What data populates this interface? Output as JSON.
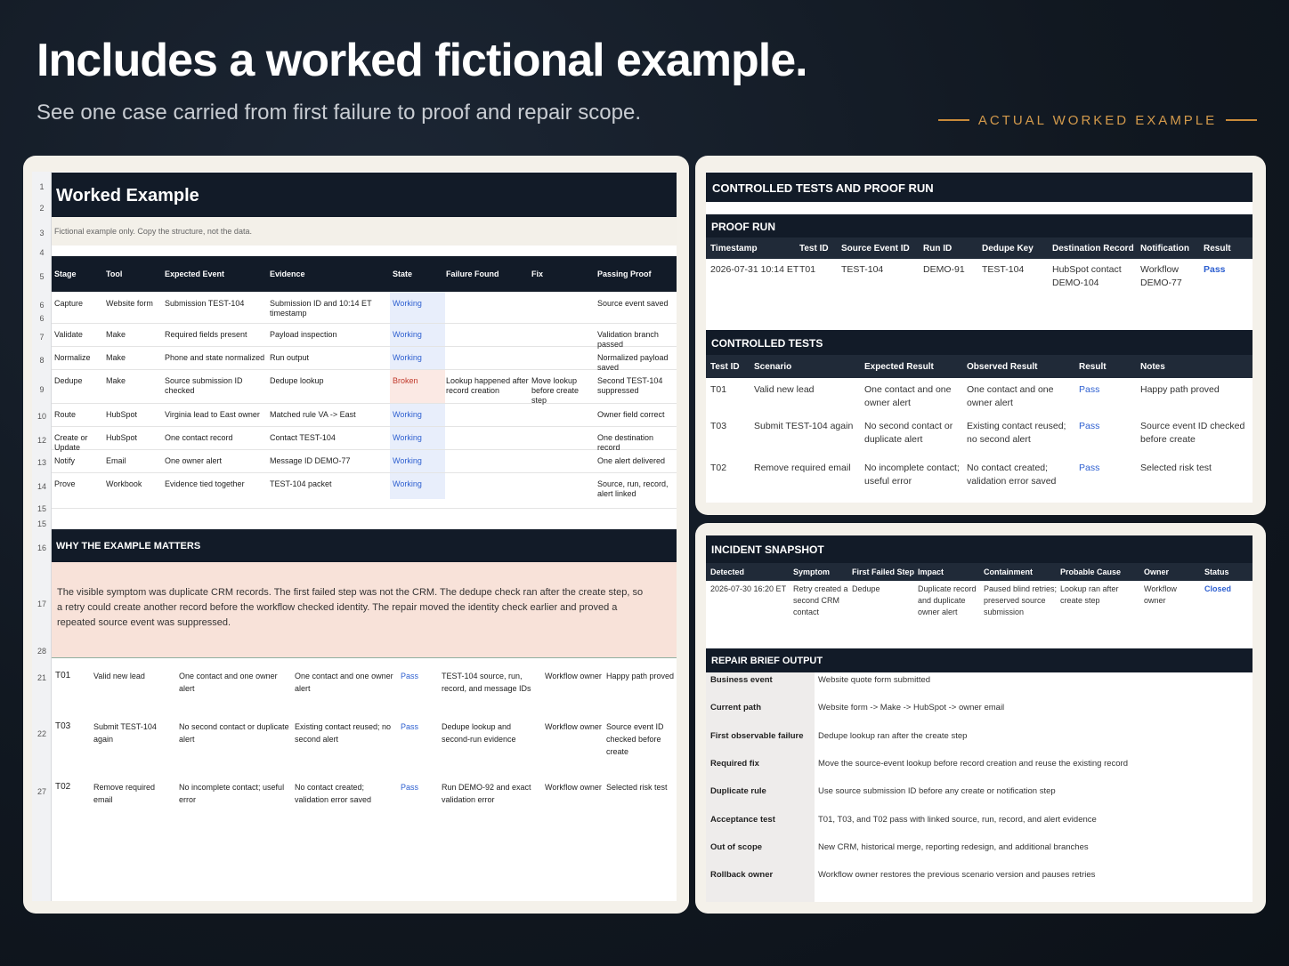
{
  "hero": {
    "title": "Includes a worked fictional example.",
    "subtitle": "See one case carried from first failure to proof and repair scope.",
    "tag": "ACTUAL WORKED EXAMPLE"
  },
  "colors": {
    "accent": "#d39a4c",
    "dark_header": "#121b28",
    "pass_blue": "#2d5fd0",
    "broken_red": "#c0392b"
  },
  "worksheet": {
    "row_numbers": [
      "1",
      "2",
      "3",
      "4",
      "5",
      "6",
      "6",
      "7",
      "8",
      "9",
      "10",
      "12",
      "13",
      "14",
      "15",
      "15",
      "16",
      "17",
      "28",
      "21",
      "22",
      "27"
    ],
    "title": "Worked Example",
    "note": "Fictional example only. Copy the structure, not the data.",
    "headers": [
      "Stage",
      "Tool",
      "Expected Event",
      "Evidence",
      "State",
      "Failure Found",
      "Fix",
      "Passing Proof"
    ],
    "rows": [
      [
        "Capture",
        "Website form",
        "Submission TEST-104",
        "Submission ID and 10:14 ET timestamp",
        "Working",
        "",
        "",
        "Source event saved"
      ],
      [
        "Validate",
        "Make",
        "Required fields present",
        "Payload inspection",
        "Working",
        "",
        "",
        "Validation branch passed"
      ],
      [
        "Normalize",
        "Make",
        "Phone and state normalized",
        "Run output",
        "Working",
        "",
        "",
        "Normalized payload saved"
      ],
      [
        "Dedupe",
        "Make",
        "Source submission ID checked",
        "Dedupe lookup",
        "Broken",
        "Lookup happened after record creation",
        "Move lookup before create step",
        "Second TEST-104 suppressed"
      ],
      [
        "Route",
        "HubSpot",
        "Virginia lead to East owner",
        "Matched rule VA -> East",
        "Working",
        "",
        "",
        "Owner field correct"
      ],
      [
        "Create or Update",
        "HubSpot",
        "One contact record",
        "Contact TEST-104",
        "Working",
        "",
        "",
        "One destination record"
      ],
      [
        "Notify",
        "Email",
        "One owner alert",
        "Message ID DEMO-77",
        "Working",
        "",
        "",
        "One alert delivered"
      ],
      [
        "Prove",
        "Workbook",
        "Evidence tied together",
        "TEST-104 packet",
        "Working",
        "",
        "",
        "Source, run, record, alert linked"
      ]
    ],
    "why_heading": "WHY THE EXAMPLE MATTERS",
    "why_text": "The visible symptom was duplicate CRM records. The first failed step was not the CRM. The dedupe check ran after the create step, so a retry could create another record before the workflow checked identity. The repair moved the identity check earlier and proved a repeated source event was suppressed.",
    "test_rows": [
      [
        "T01",
        "Valid new lead",
        "One contact and one owner alert",
        "One contact and one owner alert",
        "Pass",
        "TEST-104 source, run, record, and message IDs",
        "Workflow owner",
        "Happy path proved"
      ],
      [
        "T03",
        "Submit TEST-104 again",
        "No second contact or duplicate alert",
        "Existing contact reused; no second alert",
        "Pass",
        "Dedupe lookup and second-run evidence",
        "Workflow owner",
        "Source event ID checked before create"
      ],
      [
        "T02",
        "Remove required email",
        "No incomplete contact; useful error",
        "No contact created; validation error saved",
        "Pass",
        "Run DEMO-92 and exact validation error",
        "Workflow owner",
        "Selected risk test"
      ]
    ]
  },
  "tests_panel": {
    "title": "CONTROLLED TESTS AND PROOF RUN",
    "proof_heading": "PROOF RUN",
    "proof_headers": [
      "Timestamp",
      "Test ID",
      "Source Event ID",
      "Run ID",
      "Dedupe Key",
      "Destination Record",
      "Notification",
      "Result"
    ],
    "proof_row": [
      "2026-07-31 10:14 ET",
      "T01",
      "TEST-104",
      "DEMO-91",
      "TEST-104",
      "HubSpot contact DEMO-104",
      "Workflow DEMO-77",
      "Pass"
    ],
    "ct_heading": "CONTROLLED TESTS",
    "ct_headers": [
      "Test ID",
      "Scenario",
      "Expected Result",
      "Observed Result",
      "Result",
      "Notes"
    ],
    "ct_rows": [
      [
        "T01",
        "Valid new lead",
        "One contact and one owner alert",
        "One contact and one owner alert",
        "Pass",
        "Happy path proved"
      ],
      [
        "T03",
        "Submit TEST-104 again",
        "No second contact or duplicate alert",
        "Existing contact reused; no second alert",
        "Pass",
        "Source event ID checked before create"
      ],
      [
        "T02",
        "Remove required email",
        "No incomplete contact; useful error",
        "No contact created; validation error saved",
        "Pass",
        "Selected risk test"
      ]
    ]
  },
  "incident_panel": {
    "title": "INCIDENT SNAPSHOT",
    "headers": [
      "Detected",
      "Symptom",
      "First Failed Step",
      "Impact",
      "Containment",
      "Probable Cause",
      "Owner",
      "Status"
    ],
    "row": [
      "2026-07-30 16:20 ET",
      "Retry created a second CRM contact",
      "Dedupe",
      "Duplicate record and duplicate owner alert",
      "Paused blind retries; preserved source submission",
      "Lookup ran after create step",
      "Workflow owner",
      "Closed"
    ],
    "repair_heading": "REPAIR BRIEF OUTPUT",
    "repair_items": [
      {
        "label": "Business event",
        "value": "Website quote form submitted"
      },
      {
        "label": "Current path",
        "value": "Website form -> Make -> HubSpot -> owner email"
      },
      {
        "label": "First observable failure",
        "value": "Dedupe lookup ran after the create step"
      },
      {
        "label": "Required fix",
        "value": "Move the source-event lookup before record creation and reuse the existing record"
      },
      {
        "label": "Duplicate rule",
        "value": "Use source submission ID before any create or notification step"
      },
      {
        "label": "Acceptance test",
        "value": "T01, T03, and T02 pass with linked source, run, record, and alert evidence"
      },
      {
        "label": "Out of scope",
        "value": "New CRM, historical merge, reporting redesign, and additional branches"
      },
      {
        "label": "Rollback owner",
        "value": "Workflow owner restores the previous scenario version and pauses retries"
      }
    ]
  }
}
